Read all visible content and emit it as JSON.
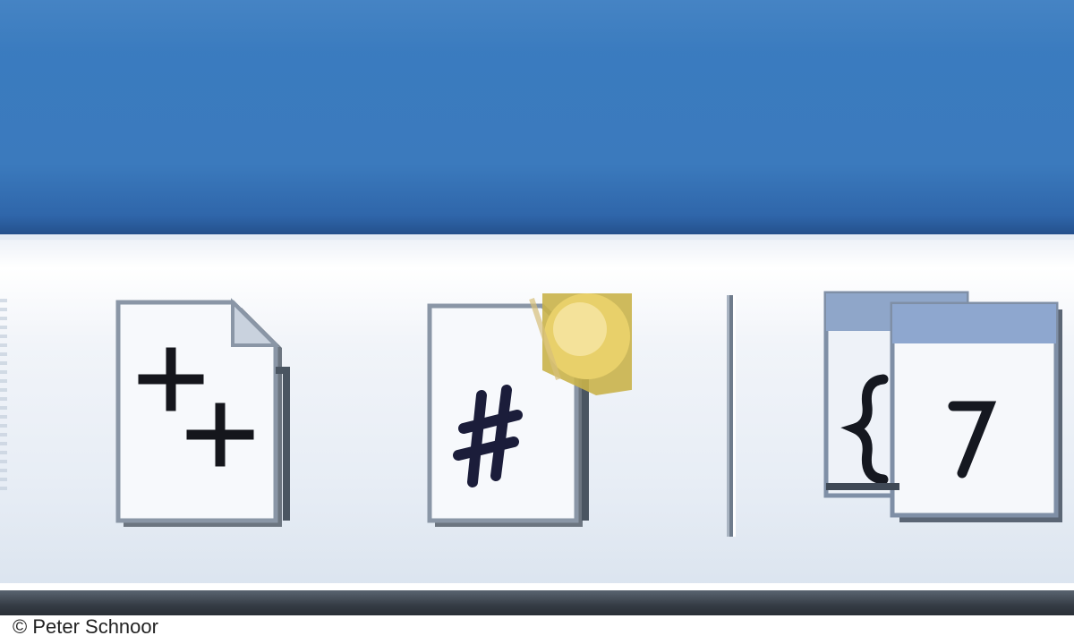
{
  "window": {
    "title_bar_color": "#3b7abd"
  },
  "toolbar": {
    "background": "#eef2f8",
    "buttons": [
      {
        "id": "cpp",
        "icon": "cpp-source-file-icon",
        "glyph": "++"
      },
      {
        "id": "csharp",
        "icon": "csharp-source-file-icon",
        "glyph": "#"
      },
      {
        "id": "class",
        "icon": "class-file-icon",
        "glyph": "{ }"
      }
    ]
  },
  "credit": {
    "text": "© Peter Schnoor"
  }
}
